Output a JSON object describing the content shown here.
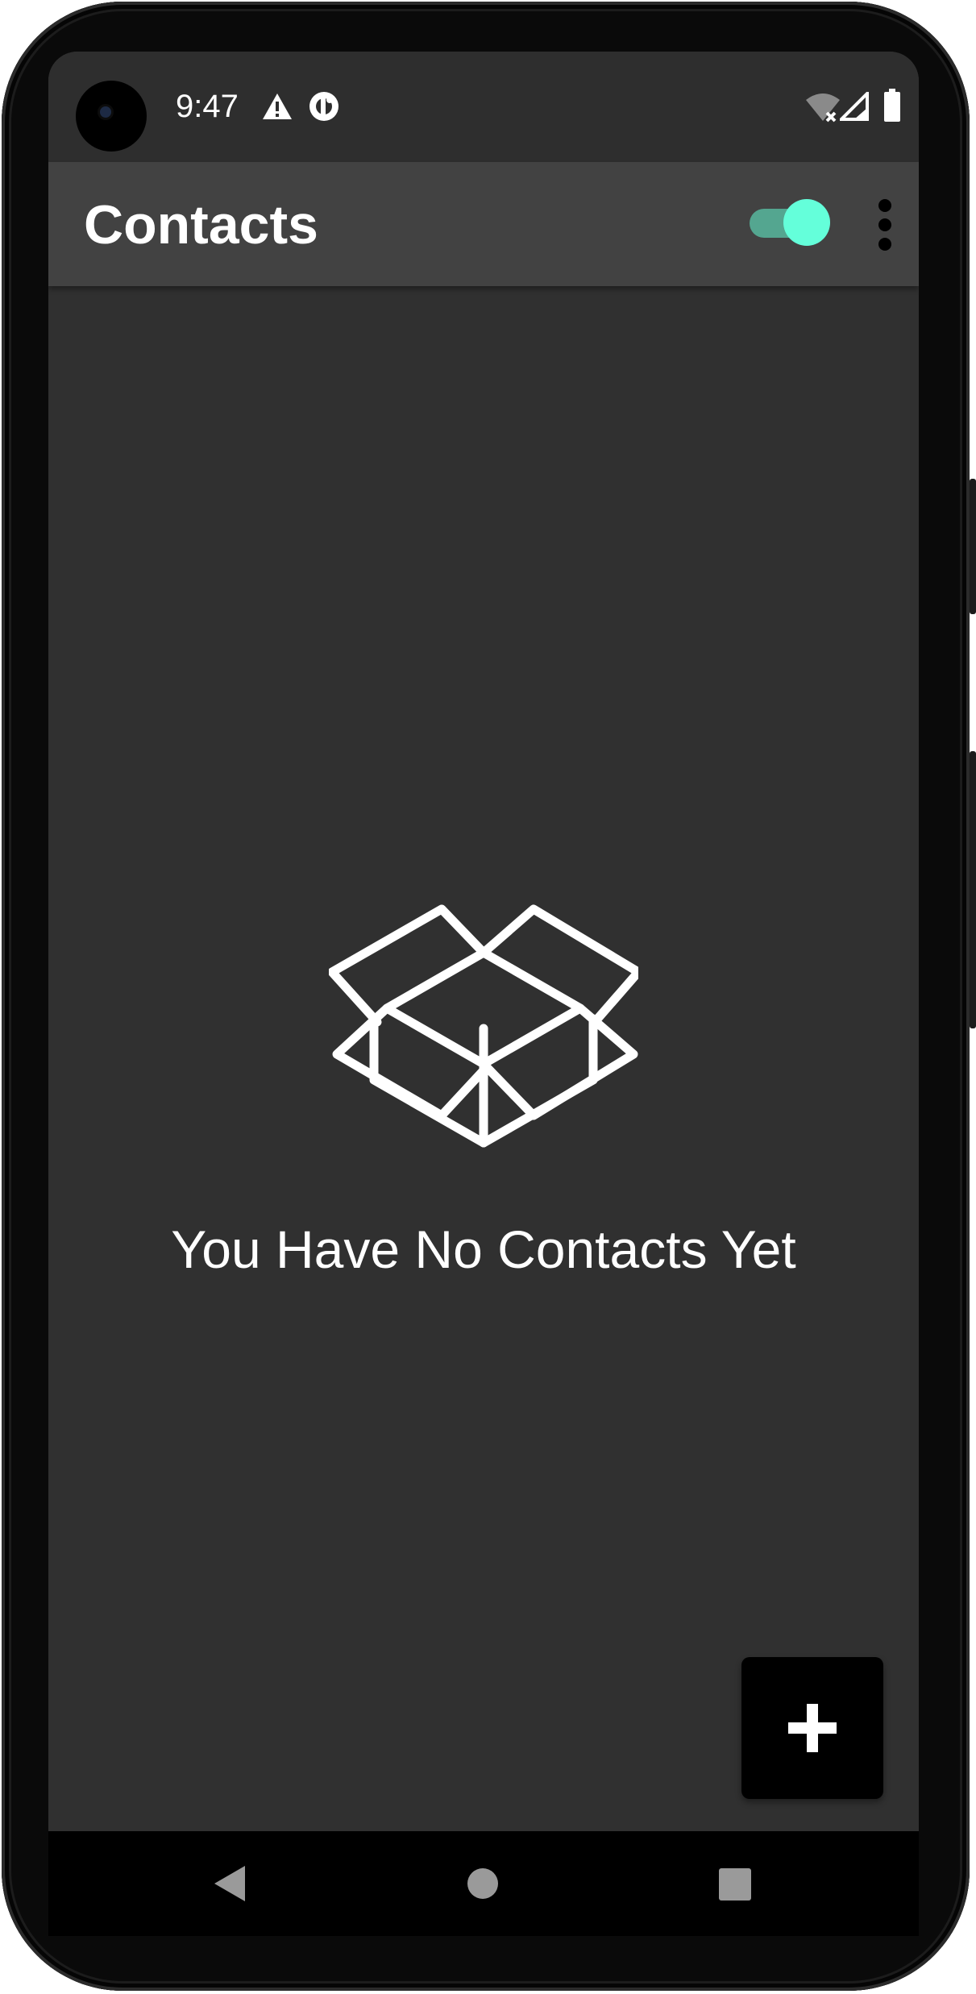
{
  "status_bar": {
    "time": "9:47",
    "icons": [
      "alert-triangle-icon",
      "data-saver-icon",
      "wifi-off-icon",
      "cell-signal-icon",
      "battery-icon"
    ]
  },
  "app_bar": {
    "title": "Contacts",
    "toggle": {
      "state": "on",
      "track_color": "#54a690",
      "thumb_color": "#64ffda"
    },
    "overflow_icon": "more-vert-icon"
  },
  "main": {
    "empty_icon": "open-box-icon",
    "empty_message": "You Have No Contacts Yet"
  },
  "fab": {
    "icon": "plus-icon",
    "background": "#000000"
  },
  "navigation_bar": {
    "buttons": [
      "back-icon",
      "home-icon",
      "recents-icon"
    ]
  },
  "colors": {
    "screen_background": "#303030",
    "app_bar_background": "#424242",
    "accent": "#64ffda",
    "text": "#ffffff"
  }
}
